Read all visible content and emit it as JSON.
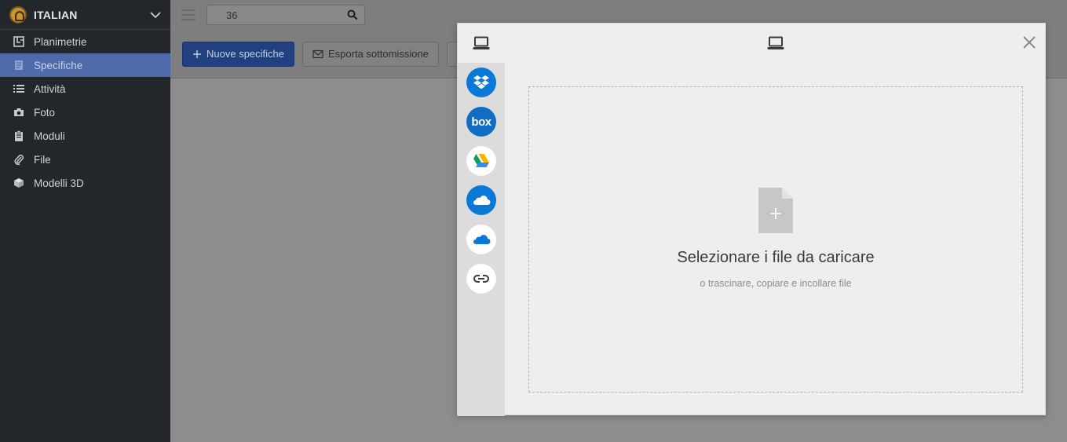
{
  "sidebar": {
    "project_name": "ITALIAN",
    "items": [
      {
        "label": "Planimetrie",
        "icon": "floorplan-icon",
        "active": false
      },
      {
        "label": "Specifiche",
        "icon": "spec-icon",
        "active": true
      },
      {
        "label": "Attività",
        "icon": "list-icon",
        "active": false
      },
      {
        "label": "Foto",
        "icon": "camera-icon",
        "active": false
      },
      {
        "label": "Moduli",
        "icon": "clipboard-icon",
        "active": false
      },
      {
        "label": "File",
        "icon": "paperclip-icon",
        "active": false
      },
      {
        "label": "Modelli 3D",
        "icon": "cube-icon",
        "active": false
      }
    ]
  },
  "topbar": {
    "search_value": "36"
  },
  "toolbar": {
    "new_spec_label": "Nuove specifiche",
    "export_label": "Esporta sottomissione"
  },
  "modal": {
    "drop_title": "Selezionare i file da caricare",
    "drop_subtitle": "o trascinare, copiare e incollare file",
    "sources": [
      "device",
      "dropbox",
      "box",
      "google-drive",
      "onedrive",
      "onedrive-business",
      "link"
    ]
  },
  "colors": {
    "sidebar_bg": "#23272b",
    "active_item": "#4e6aa8",
    "primary_button": "#21407f",
    "dropbox_blue": "#0a78d7"
  }
}
